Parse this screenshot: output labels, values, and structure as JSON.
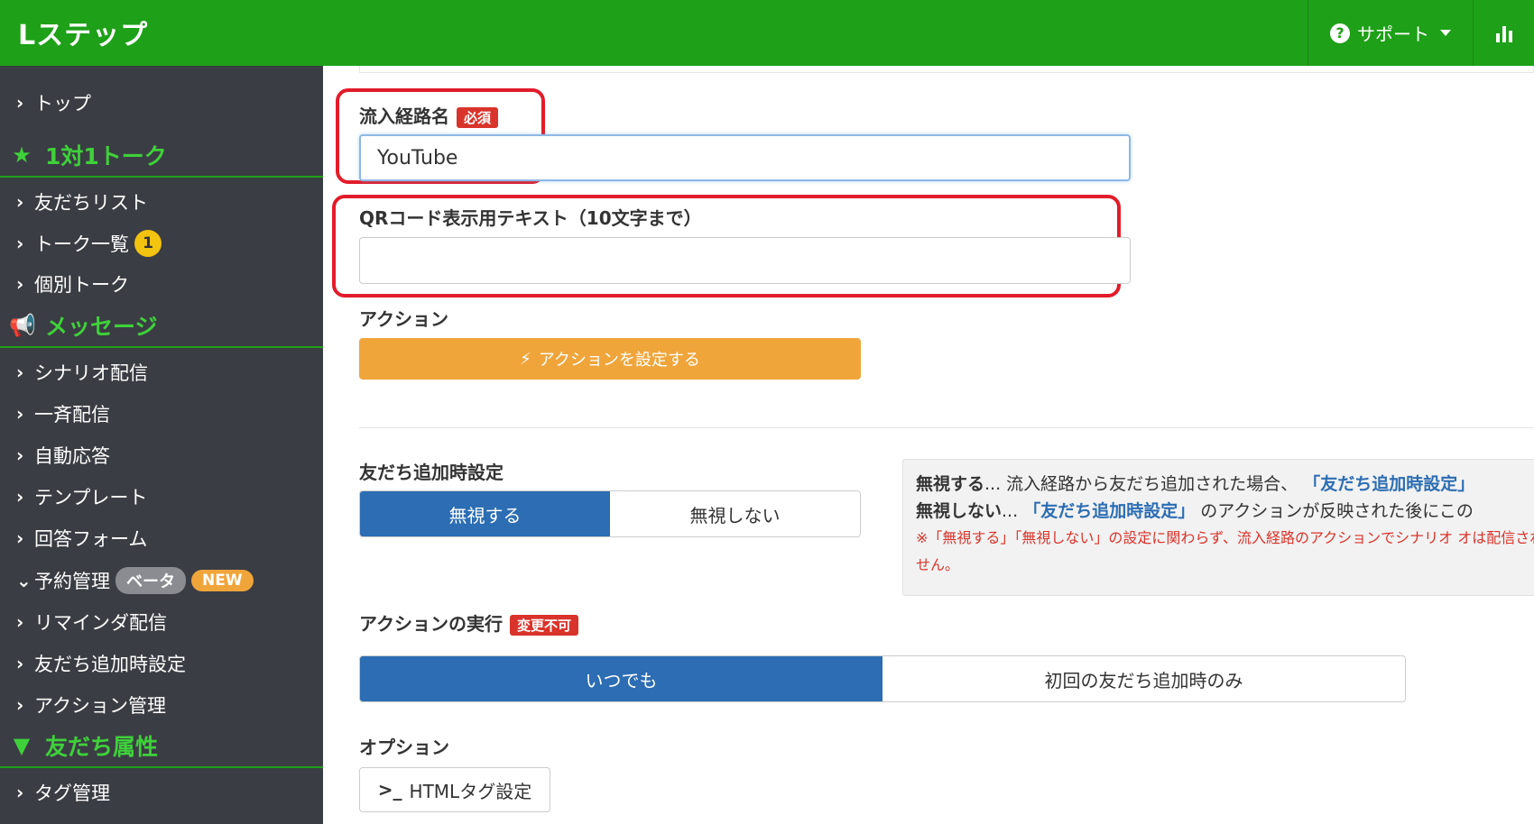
{
  "app": {
    "logo": "Lステップ"
  },
  "topbar": {
    "support_label": "サポート",
    "help_icon_glyph": "?"
  },
  "sidebar": {
    "items": [
      {
        "label": "トップ"
      },
      {
        "label": "1対1トーク",
        "section": true
      },
      {
        "label": "友だちリスト"
      },
      {
        "label": "トーク一覧",
        "badge": "1"
      },
      {
        "label": "個別トーク"
      },
      {
        "label": "メッセージ",
        "section": true
      },
      {
        "label": "シナリオ配信"
      },
      {
        "label": "一斉配信"
      },
      {
        "label": "自動応答"
      },
      {
        "label": "テンプレート"
      },
      {
        "label": "回答フォーム"
      },
      {
        "label": "予約管理",
        "badge_beta": "ベータ",
        "badge_new": "NEW"
      },
      {
        "label": "リマインダ配信"
      },
      {
        "label": "友だち追加時設定"
      },
      {
        "label": "アクション管理"
      },
      {
        "label": "友だち属性",
        "section": true
      },
      {
        "label": "タグ管理"
      }
    ]
  },
  "form": {
    "route_name": {
      "label": "流入経路名",
      "required": "必須",
      "value": "YouTube"
    },
    "qr_text": {
      "label": "QRコード表示用テキスト（10文字まで）",
      "value": ""
    },
    "action": {
      "label": "アクション",
      "button": "アクションを設定する"
    },
    "friend_add": {
      "label": "友だち追加時設定",
      "options": [
        "無視する",
        "無視しない"
      ],
      "selected": "無視する",
      "note": {
        "line1_bold": "無視する",
        "line1_text": "... 流入経路から友だち追加された場合、",
        "line1_link": "「友だち追加時設定」",
        "line2_bold": "無視しない",
        "line2_text1": "...",
        "line2_link": "「友だち追加時設定」",
        "line2_text2": "のアクションが反映された後にこの",
        "warning": "※「無視する」「無視しない」の設定に関わらず、流入経路のアクションでシナリオ オは配信されません。"
      }
    },
    "execution": {
      "label": "アクションの実行",
      "badge": "変更不可",
      "options": [
        "いつでも",
        "初回の友だち追加時のみ"
      ],
      "selected": "いつでも"
    },
    "option": {
      "label": "オプション",
      "button": "HTMLタグ設定"
    }
  },
  "colors": {
    "header_green": "#1ea018",
    "sidebar": "#3b3d44",
    "accent_blue": "#2c6db3",
    "orange": "#f0a53b",
    "red": "#e21c2a"
  }
}
